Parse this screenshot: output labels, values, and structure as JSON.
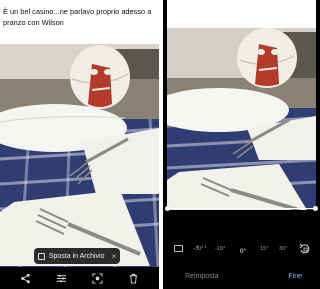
{
  "post": {
    "caption": "È un bel casino...ne parlavo proprio adesso a pranzo con Wilson"
  },
  "viewer": {
    "toast_label": "Sposta in Archivio",
    "toast_close": "×",
    "toolbar": [
      {
        "name": "share-icon"
      },
      {
        "name": "edit-adjust-icon"
      },
      {
        "name": "lens-icon"
      },
      {
        "name": "trash-icon"
      }
    ]
  },
  "editor": {
    "angle_labels": [
      "-30°",
      "-15°",
      "0°",
      "15°",
      "30°"
    ],
    "current_angle": "0°",
    "reset_label": "Reimposta",
    "done_label": "Fine",
    "accent_color": "#8ab4f8"
  }
}
